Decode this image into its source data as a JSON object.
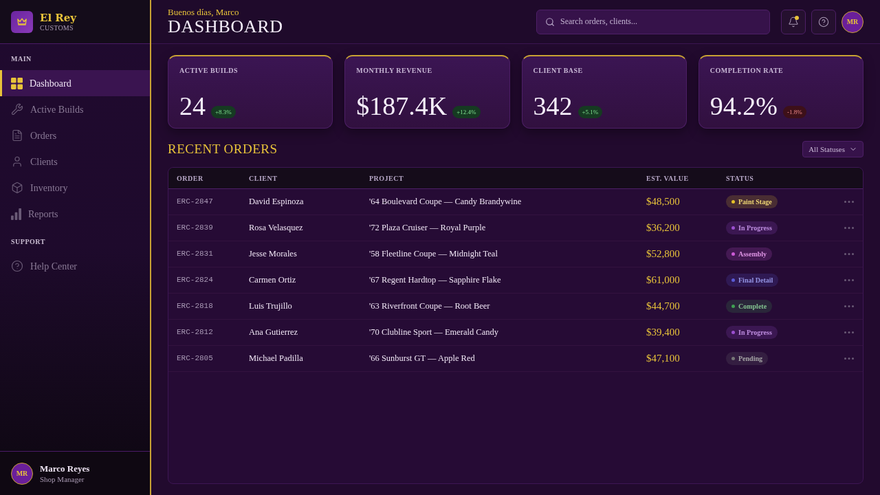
{
  "sidebar": {
    "brand": {
      "name": "El Rey",
      "tagline": "CUSTOMS"
    },
    "sections": [
      {
        "heading": "MAIN",
        "items": [
          {
            "label": "Dashboard",
            "selected": true
          },
          {
            "label": "Active Builds",
            "selected": false
          },
          {
            "label": "Orders",
            "selected": false
          },
          {
            "label": "Clients",
            "selected": false
          },
          {
            "label": "Inventory",
            "selected": false
          },
          {
            "label": "Reports",
            "selected": false
          }
        ]
      },
      {
        "heading": "SUPPORT",
        "items": [
          {
            "label": "Help Center",
            "selected": false
          }
        ]
      }
    ],
    "user": {
      "initials": "MR",
      "name": "Marco Reyes",
      "role": "Shop Manager"
    }
  },
  "header": {
    "greeting": "Buenos días, Marco",
    "title": "DASHBOARD",
    "search": {
      "placeholder": "Search orders, clients..."
    },
    "notifications": {
      "unread": true
    },
    "avatar": {
      "initials": "MR"
    }
  },
  "stats": [
    {
      "label": "ACTIVE BUILDS",
      "value": "24",
      "change": "+8.3%",
      "negative": false
    },
    {
      "label": "MONTHLY REVENUE",
      "value": "$187.4K",
      "change": "+12.4%",
      "negative": false
    },
    {
      "label": "CLIENT BASE",
      "value": "342",
      "change": "+5.1%",
      "negative": false
    },
    {
      "label": "COMPLETION RATE",
      "value": "94.2%",
      "change": "-1.8%",
      "negative": true
    }
  ],
  "orders": {
    "title": "RECENT ORDERS",
    "filter": {
      "value": "All Statuses"
    },
    "columns": [
      "ORDER",
      "CLIENT",
      "PROJECT",
      "EST. VALUE",
      "STATUS"
    ],
    "rows": [
      {
        "order": "ERC-2847",
        "client": "David Espinoza",
        "project": "'64 Boulevard Coupe — Candy Brandywine",
        "value": "$48,500",
        "status": {
          "label": "Paint Stage",
          "color": "#e6c229"
        }
      },
      {
        "order": "ERC-2839",
        "client": "Rosa Velasquez",
        "project": "'72 Plaza Cruiser — Royal Purple",
        "value": "$36,200",
        "status": {
          "label": "In Progress",
          "color": "#9b4fd0"
        }
      },
      {
        "order": "ERC-2831",
        "client": "Jesse Morales",
        "project": "'58 Fleetline Coupe — Midnight Teal",
        "value": "$52,800",
        "status": {
          "label": "Assembly",
          "color": "#cc5bd6"
        }
      },
      {
        "order": "ERC-2824",
        "client": "Carmen Ortiz",
        "project": "'67 Regent Hardtop — Sapphire Flake",
        "value": "$61,000",
        "status": {
          "label": "Final Detail",
          "color": "#5b5bd6"
        }
      },
      {
        "order": "ERC-2818",
        "client": "Luis Trujillo",
        "project": "'63 Riverfront Coupe — Root Beer",
        "value": "$44,700",
        "status": {
          "label": "Complete",
          "color": "#3fa052"
        }
      },
      {
        "order": "ERC-2812",
        "client": "Ana Gutierrez",
        "project": "'70 Clubline Sport — Emerald Candy",
        "value": "$39,400",
        "status": {
          "label": "In Progress",
          "color": "#9b4fd0"
        }
      },
      {
        "order": "ERC-2805",
        "client": "Michael Padilla",
        "project": "'66 Sunburst GT — Apple Red",
        "value": "$47,100",
        "status": {
          "label": "Pending",
          "color": "#777777"
        }
      }
    ]
  }
}
